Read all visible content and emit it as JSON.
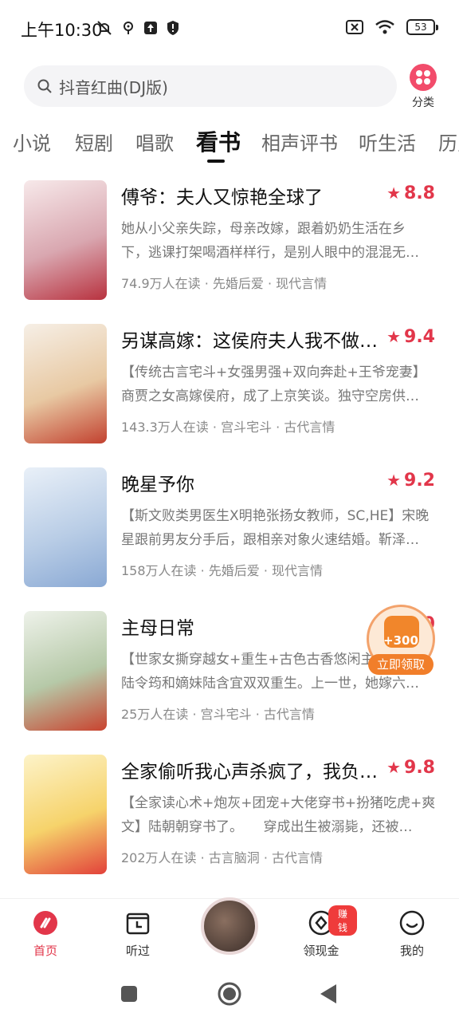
{
  "status_bar": {
    "time": "上午10:30",
    "battery": "53"
  },
  "search": {
    "query": "抖音红曲(DJ版)"
  },
  "category": {
    "label": "分类"
  },
  "tabs": [
    "小说",
    "短剧",
    "唱歌",
    "看书",
    "相声评书",
    "听生活",
    "历史"
  ],
  "active_tab": "看书",
  "books": [
    {
      "title": "傅爷：夫人又惊艳全球了",
      "rating": "8.8",
      "desc_line1": "她从小父亲失踪，母亲改嫁，跟着奶奶生活在乡",
      "desc_line2": "下，逃课打架喝酒样样行，是别人眼中的混混无…",
      "meta": "74.9万人在读 · 先婚后爱 · 现代言情",
      "cover_colors": [
        "#f7e9ea",
        "#d9a7b0",
        "#b8323f"
      ]
    },
    {
      "title": "另谋高嫁：这侯府夫人我不做…",
      "rating": "9.4",
      "desc_line1": "【传统古言宅斗+女强男强+双向奔赴+王爷宠妻】",
      "desc_line2": "商贾之女高嫁侯府，成了上京笑谈。独守空房供…",
      "meta": "143.3万人在读 · 宫斗宅斗 · 古代言情",
      "cover_colors": [
        "#f6efe6",
        "#e8c9a3",
        "#c2412f"
      ]
    },
    {
      "title": "晚星予你",
      "rating": "9.2",
      "desc_line1": "【斯文败类男医生X明艳张扬女教师，SC,HE】宋晚",
      "desc_line2": "星跟前男友分手后，跟相亲对象火速结婚。靳泽…",
      "meta": "158万人在读 · 先婚后爱 · 现代言情",
      "cover_colors": [
        "#e9f0f8",
        "#b9cde6",
        "#8aa9d4"
      ]
    },
    {
      "title": "主母日常",
      "rating": "9.0",
      "desc_line1": "【世家女撕穿越女+重生+古色古香悠闲主",
      "desc_line2": "陆令筠和嫡妹陆含宜双双重生。上一世，她嫁六…",
      "meta": "25万人在读 · 宫斗宅斗 · 古代言情",
      "cover_colors": [
        "#eef2ea",
        "#b6c9a8",
        "#c9432f"
      ]
    },
    {
      "title": "全家偷听我心声杀疯了，我负…",
      "rating": "9.8",
      "desc_line1": "【全家读心术+炮灰+团宠+大佬穿书+扮猪吃虎+爽",
      "desc_line2": "文】陆朝朝穿书了。　　穿成出生被溺毙，还被…",
      "meta": "202万人在读 · 古言脑洞 · 古代言情",
      "cover_colors": [
        "#fdf3c9",
        "#f6d36b",
        "#e2413a"
      ]
    }
  ],
  "reward": {
    "amount": "+300",
    "button": "立即领取"
  },
  "bottom_nav": [
    {
      "label": "首页",
      "icon": "home-icon",
      "active": true
    },
    {
      "label": "听过",
      "icon": "calendar-icon",
      "active": false
    },
    {
      "label": "领现金",
      "icon": "diamond-icon",
      "active": false,
      "badge": "赚钱"
    },
    {
      "label": "我的",
      "icon": "smile-icon",
      "active": false
    }
  ],
  "colors": {
    "accent": "#e2364a",
    "reward": "#f17e2a"
  }
}
